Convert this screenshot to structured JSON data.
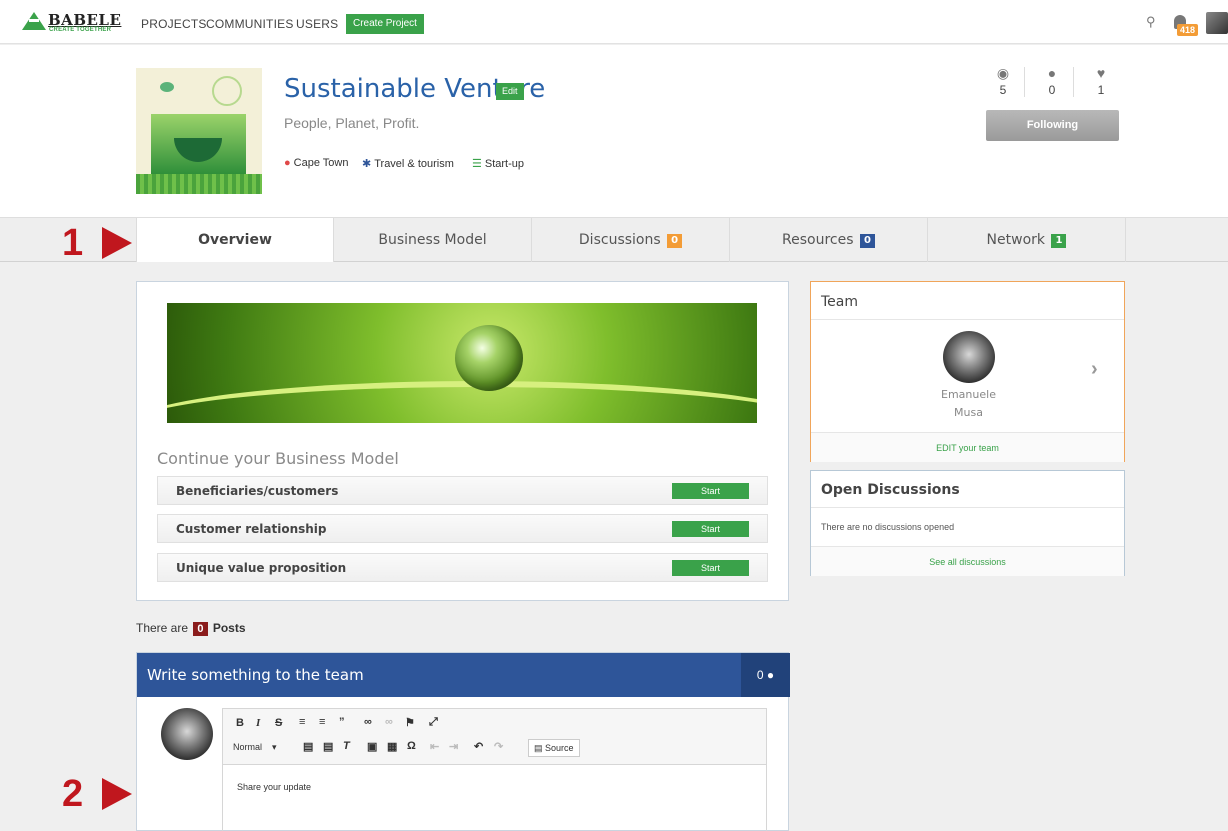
{
  "nav": {
    "brand": "BABELE",
    "brand_tagline": "CREATE TOGETHER",
    "links": [
      "PROJECTS",
      "COMMUNITIES",
      "USERS"
    ],
    "create_label": "Create Project",
    "notifications": "418"
  },
  "project": {
    "title": "Sustainable Venture",
    "edit_label": "Edit",
    "subtitle": "People, Planet, Profit.",
    "location": "Cape Town",
    "sector": "Travel & tourism",
    "stage": "Start-up",
    "stats": {
      "views": "5",
      "comments": "0",
      "likes": "1"
    },
    "follow_label": "Following"
  },
  "tabs": [
    {
      "label": "Overview"
    },
    {
      "label": "Business Model"
    },
    {
      "label": "Discussions",
      "count": "0",
      "color": "#f39c36"
    },
    {
      "label": "Resources",
      "count": "0",
      "color": "#2e5599"
    },
    {
      "label": "Network",
      "count": "1",
      "color": "#3aa24a"
    }
  ],
  "annotations": {
    "first": "1",
    "second": "2"
  },
  "business_model": {
    "heading": "Continue your Business Model",
    "rows": [
      {
        "label": "Beneficiaries/customers",
        "button": "Start"
      },
      {
        "label": "Customer relationship",
        "button": "Start"
      },
      {
        "label": "Unique value proposition",
        "button": "Start"
      }
    ]
  },
  "team": {
    "title": "Team",
    "member_first": "Emanuele",
    "member_last": "Musa",
    "edit_label": "EDIT your team"
  },
  "discussions": {
    "title": "Open Discussions",
    "empty": "There are no discussions opened",
    "see_all": "See all discussions"
  },
  "posts": {
    "prefix": "There are",
    "count": "0",
    "suffix": "Posts"
  },
  "composer": {
    "title": "Write something to the team",
    "count": "0",
    "format": "Normal",
    "source_label": "Source",
    "placeholder": "Share your update"
  },
  "colors": {
    "brand_green": "#3aa24a",
    "header_blue": "#2e5599",
    "accent_orange": "#f39c36",
    "annotation_red": "#c0171e"
  }
}
